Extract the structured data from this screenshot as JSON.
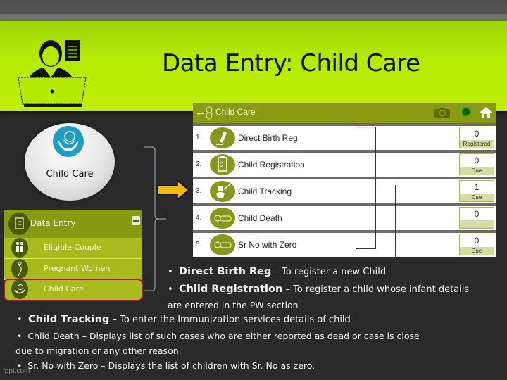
{
  "slide": {
    "title": "Data Entry: Child Care",
    "watermark": "fppt.com"
  },
  "app": {
    "header_title": "Child Care",
    "status_dot_color": "#2fa21c",
    "rows": [
      {
        "num": "1.",
        "label": "Direct Birth Reg",
        "count": "0",
        "sub": "Registered"
      },
      {
        "num": "2.",
        "label": "Child Registration",
        "count": "0",
        "sub": "Due"
      },
      {
        "num": "3.",
        "label": "Child Tracking",
        "count": "1",
        "sub": "Due"
      },
      {
        "num": "4.",
        "label": "Child Death",
        "count": "0",
        "sub": ""
      },
      {
        "num": "5.",
        "label": "Sr No with Zero",
        "count": "0",
        "sub": "Due"
      }
    ]
  },
  "circle": {
    "label": "Child Care"
  },
  "menu": {
    "header": "Data Entry",
    "items": [
      {
        "label": "Eligible Couple"
      },
      {
        "label": "Pregnant Women"
      },
      {
        "label": "Child Care",
        "selected": true
      }
    ]
  },
  "bullets": [
    {
      "term": "Direct Birth Reg",
      "sep": " – ",
      "desc": "To register a new Child"
    },
    {
      "term": "Child Registration",
      "sep": " – ",
      "desc": "To register a child whose infant details"
    },
    {
      "cont": "are entered in the PW section"
    },
    {
      "term": "Child Tracking",
      "sep": " – ",
      "desc": "To enter the Immunization services details of child"
    },
    {
      "term": "Child Death",
      "sep": " –  ",
      "desc": "Displays list of such cases who are either reported as dead or case is close"
    },
    {
      "cont": "due to migration or any other reason."
    },
    {
      "term": "Sr. No with Zero",
      "sep": " –  ",
      "desc": "Displays the list of  children with Sr. No as zero."
    }
  ],
  "colors": {
    "banner": "#b4ea06",
    "app_header": "#8a9a14",
    "icon_olive": "#87971d",
    "menu_item": "#a7bb1c",
    "highlight_red": "#b21823",
    "arrow": "#f6b70f",
    "baby_icon_blue": "#1d9fc4"
  }
}
